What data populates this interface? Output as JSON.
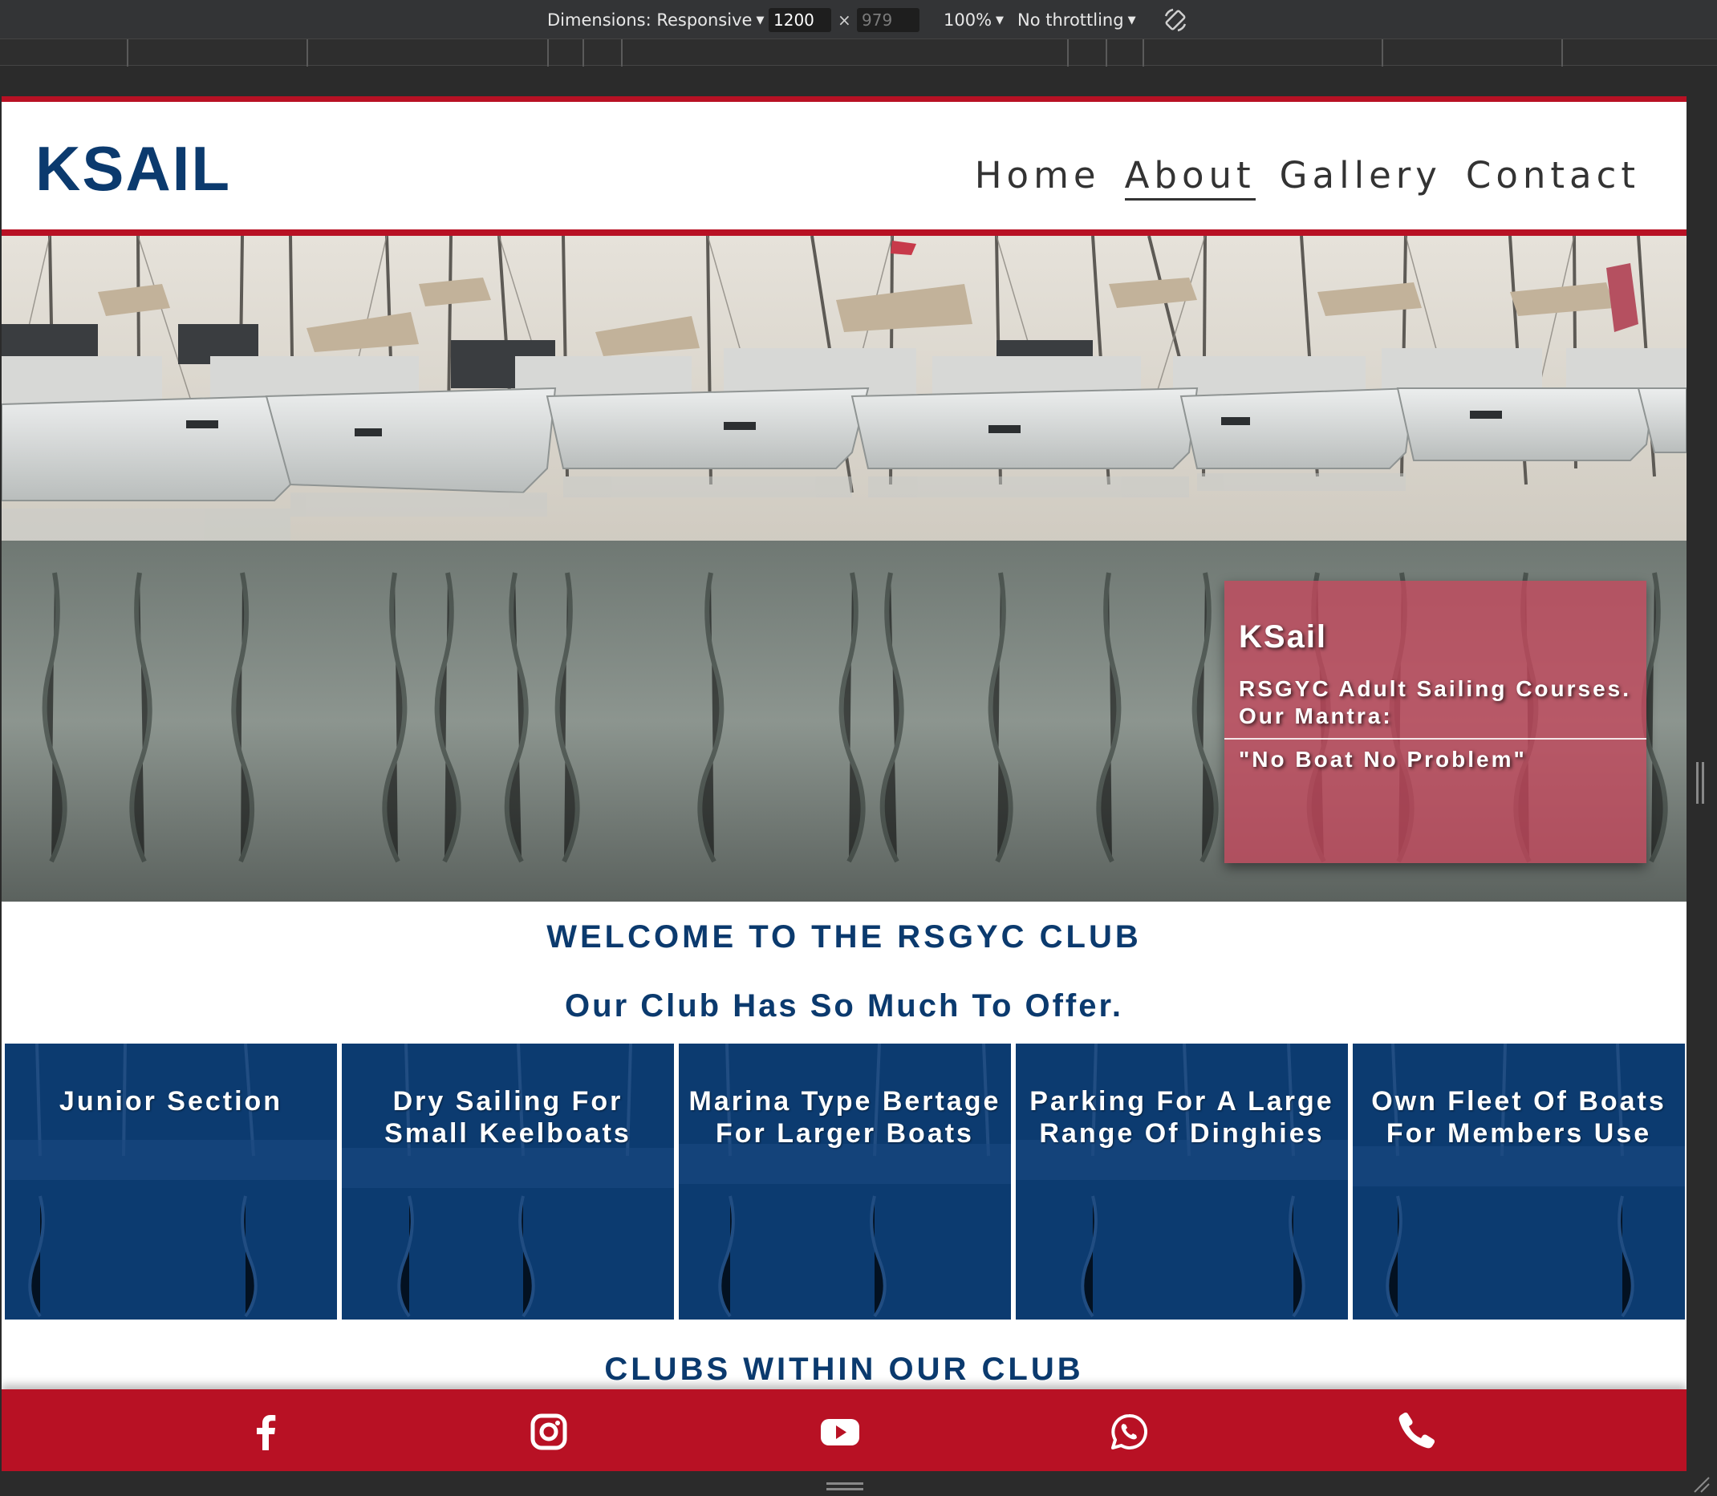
{
  "devtools": {
    "dimensions_label": "Dimensions: Responsive",
    "width": "1200",
    "height": "979",
    "times": "×",
    "zoom": "100%",
    "throttling": "No throttling"
  },
  "site": {
    "logo": "KSAIL",
    "nav": [
      {
        "label": "Home",
        "active": false
      },
      {
        "label": "About",
        "active": true
      },
      {
        "label": "Gallery",
        "active": false
      },
      {
        "label": "Contact",
        "active": false
      }
    ]
  },
  "hero": {
    "title": "KSail",
    "tagline": "RSGYC Adult Sailing Courses. Our Mantra:",
    "mantra": "\"No Boat No Problem\""
  },
  "welcome": {
    "title": "WELCOME TO THE RSGYC CLUB",
    "subtitle": "Our Club Has So Much To Offer."
  },
  "features": [
    "Junior Section",
    "Dry Sailing For Small Keelboats",
    "Marina Type Bertage For Larger Boats",
    "Parking For A Large Range Of Dinghies",
    "Own Fleet Of Boats For Members Use"
  ],
  "clubs_title": "CLUBS WITHIN OUR CLUB",
  "social_icons": [
    "facebook-icon",
    "instagram-icon",
    "youtube-icon",
    "whatsapp-icon",
    "phone-icon"
  ],
  "colors": {
    "brand_navy": "#0b3a6e",
    "brand_red": "#b81124"
  }
}
